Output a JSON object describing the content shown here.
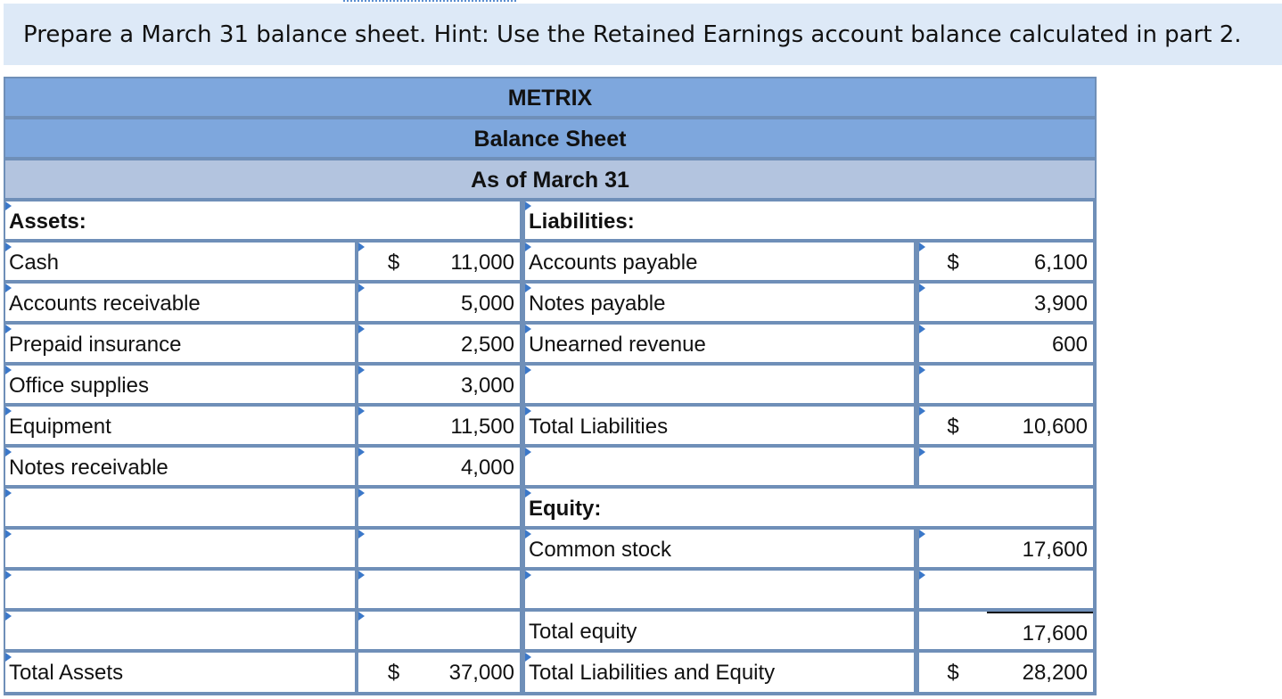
{
  "instruction": "Prepare a March 31 balance sheet. Hint: Use the Retained Earnings account balance calculated in part 2.",
  "sheet": {
    "company": "METRIX",
    "title": "Balance Sheet",
    "date": "As of March 31"
  },
  "assets": {
    "heading": "Assets:",
    "items": [
      {
        "label": "Cash",
        "currency": "$",
        "amount": "11,000"
      },
      {
        "label": "Accounts receivable",
        "currency": "",
        "amount": "5,000"
      },
      {
        "label": "Prepaid insurance",
        "currency": "",
        "amount": "2,500"
      },
      {
        "label": "Office supplies",
        "currency": "",
        "amount": "3,000"
      },
      {
        "label": "Equipment",
        "currency": "",
        "amount": "11,500"
      },
      {
        "label": "Notes receivable",
        "currency": "",
        "amount": "4,000"
      },
      {
        "label": "",
        "currency": "",
        "amount": ""
      },
      {
        "label": "",
        "currency": "",
        "amount": ""
      },
      {
        "label": "",
        "currency": "",
        "amount": ""
      },
      {
        "label": "",
        "currency": "",
        "amount": ""
      }
    ],
    "total_label": "Total Assets",
    "total_currency": "$",
    "total_amount": "37,000"
  },
  "liabilities": {
    "heading": "Liabilities:",
    "items": [
      {
        "label": "Accounts payable",
        "currency": "$",
        "amount": "6,100"
      },
      {
        "label": "Notes payable",
        "currency": "",
        "amount": "3,900"
      },
      {
        "label": "Unearned revenue",
        "currency": "",
        "amount": "600"
      },
      {
        "label": "",
        "currency": "",
        "amount": ""
      },
      {
        "label": "Total Liabilities",
        "currency": "$",
        "amount": "10,600"
      },
      {
        "label": "",
        "currency": "",
        "amount": ""
      }
    ]
  },
  "equity": {
    "heading": "Equity:",
    "items": [
      {
        "label": "Common stock",
        "currency": "",
        "amount": "17,600"
      },
      {
        "label": "",
        "currency": "",
        "amount": ""
      }
    ],
    "total_label": "Total equity",
    "total_amount": "17,600"
  },
  "grand_total": {
    "label": "Total Liabilities and Equity",
    "currency": "$",
    "amount": "28,200"
  }
}
